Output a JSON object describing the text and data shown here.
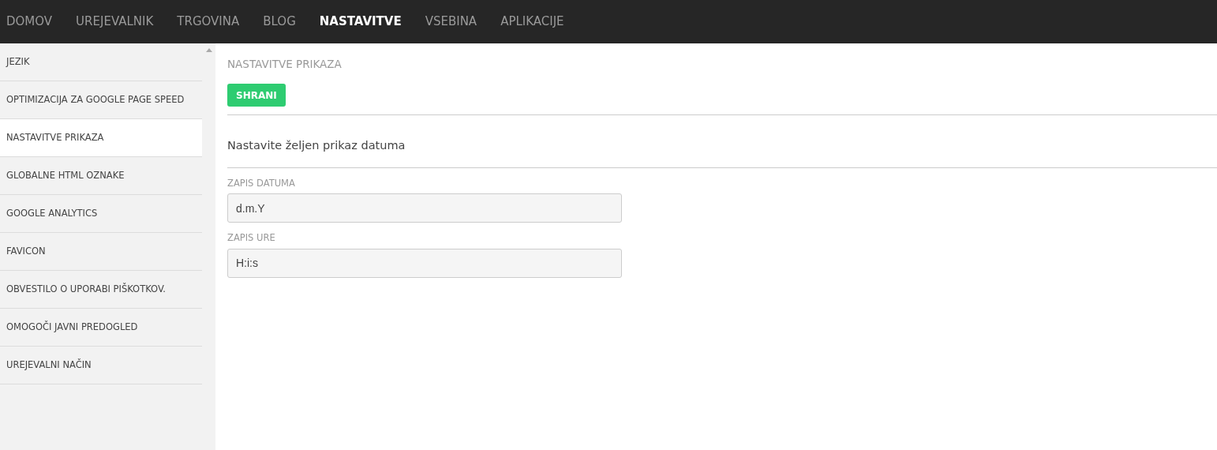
{
  "nav": [
    {
      "label": "DOMOV",
      "selected": false
    },
    {
      "label": "UREJEVALNIK",
      "selected": false
    },
    {
      "label": "TRGOVINA",
      "selected": false
    },
    {
      "label": "BLOG",
      "selected": false
    },
    {
      "label": "NASTAVITVE",
      "selected": true
    },
    {
      "label": "VSEBINA",
      "selected": false
    },
    {
      "label": "APLIKACIJE",
      "selected": false
    }
  ],
  "sidebar": {
    "items": [
      {
        "label": "JEZIK",
        "selected": false
      },
      {
        "label": "OPTIMIZACIJA ZA GOOGLE PAGE SPEED",
        "selected": false
      },
      {
        "label": "NASTAVITVE PRIKAZA",
        "selected": true
      },
      {
        "label": "GLOBALNE HTML OZNAKE",
        "selected": false
      },
      {
        "label": "GOOGLE ANALYTICS",
        "selected": false
      },
      {
        "label": "FAVICON",
        "selected": false
      },
      {
        "label": "OBVESTILO O UPORABI PIŠKOTKOV.",
        "selected": false
      },
      {
        "label": "OMOGOČI JAVNI PREDOGLED",
        "selected": false
      },
      {
        "label": "UREJEVALNI NAČIN",
        "selected": false
      }
    ]
  },
  "main": {
    "title": "NASTAVITVE PRIKAZA",
    "save_button": "SHRANI",
    "section_title": "Nastavite željen prikaz datuma",
    "fields": [
      {
        "label": "ZAPIS DATUMA",
        "value": "d.m.Y"
      },
      {
        "label": "ZAPIS URE",
        "value": "H:i:s"
      }
    ]
  }
}
